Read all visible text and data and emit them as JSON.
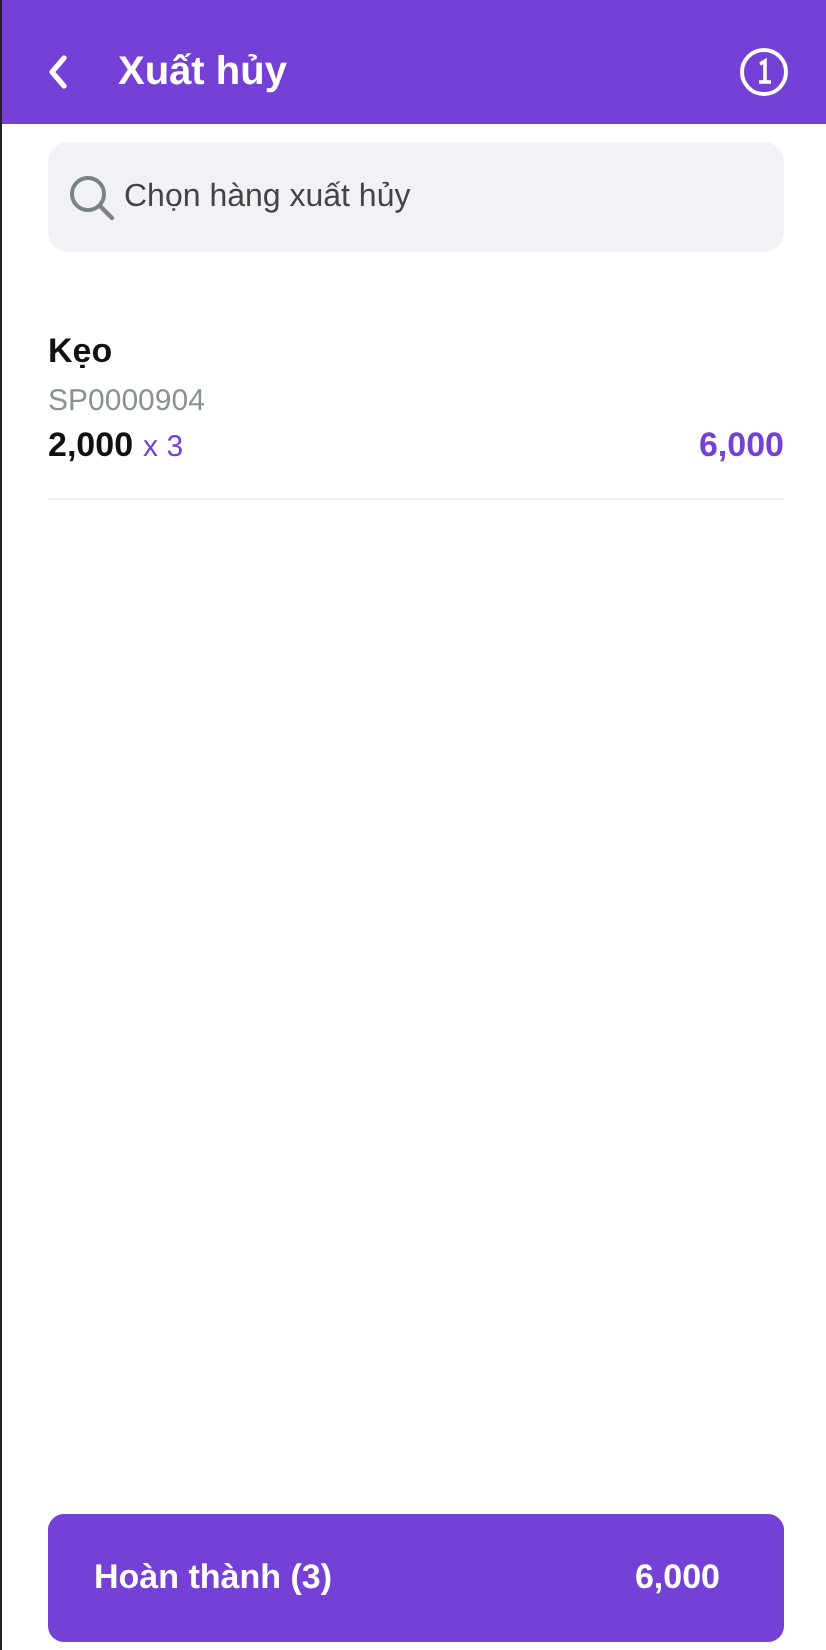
{
  "header": {
    "title": "Xuất hủy"
  },
  "search": {
    "placeholder": "Chọn hàng xuất hủy"
  },
  "items": [
    {
      "name": "Kẹo",
      "code": "SP0000904",
      "price": "2,000",
      "quantity": "x 3",
      "total": "6,000"
    }
  ],
  "footer": {
    "label": "Hoàn thành (3)",
    "total": "6,000"
  }
}
